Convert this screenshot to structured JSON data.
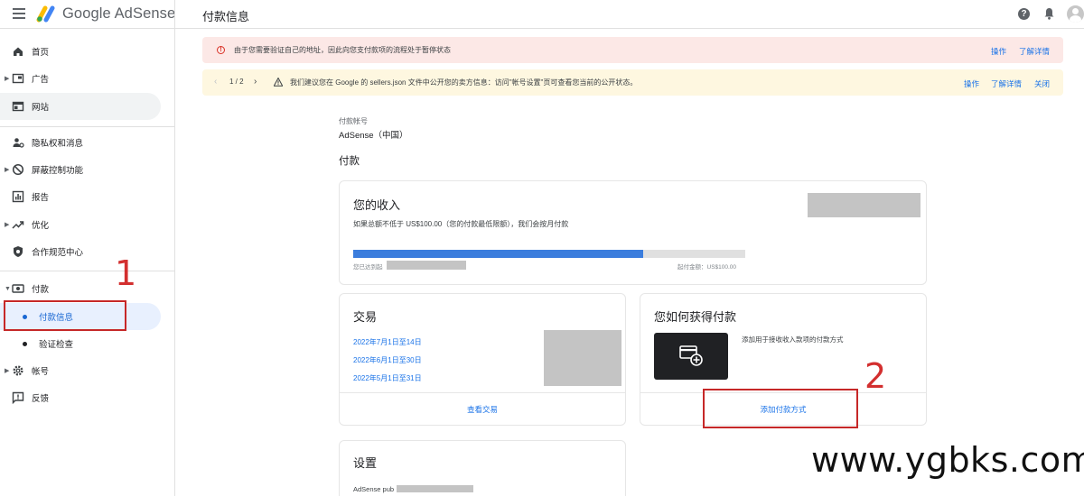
{
  "app": {
    "brand": "Google AdSense",
    "page_title": "付款信息",
    "icons": [
      "menu-icon",
      "adsense-logo",
      "help-icon",
      "bell-icon",
      "avatar"
    ]
  },
  "sidebar": {
    "items": [
      {
        "label": "首页",
        "icon": "home-icon",
        "expandable": false
      },
      {
        "label": "广告",
        "icon": "ads-icon",
        "expandable": true
      },
      {
        "label": "网站",
        "icon": "sites-icon",
        "expandable": false
      },
      {
        "label": "隐私权和消息",
        "icon": "privacy-icon",
        "expandable": false
      },
      {
        "label": "屏蔽控制功能",
        "icon": "block-icon",
        "expandable": true
      },
      {
        "label": "报告",
        "icon": "reports-icon",
        "expandable": false
      },
      {
        "label": "优化",
        "icon": "optimize-icon",
        "expandable": true
      },
      {
        "label": "合作规范中心",
        "icon": "policy-icon",
        "expandable": false
      },
      {
        "label": "付款",
        "icon": "payments-icon",
        "expandable": true,
        "expanded": true
      },
      {
        "label": "付款信息",
        "sub": true,
        "active": true
      },
      {
        "label": "验证检查",
        "sub": true
      },
      {
        "label": "帐号",
        "icon": "gear-icon",
        "expandable": true
      },
      {
        "label": "反馈",
        "icon": "feedback-icon",
        "expandable": false
      }
    ]
  },
  "alerts": {
    "error": {
      "message": "由于您需要验证自己的地址，因此向您支付款项的流程处于暂停状态",
      "actions": [
        "操作",
        "了解详情"
      ]
    },
    "warning": {
      "pager": "1 / 2",
      "message": "我们建议您在 Google 的 sellers.json 文件中公开您的卖方信息：访问\"帐号设置\"页可查看您当前的公开状态。",
      "actions": [
        "操作",
        "了解详情",
        "关闭"
      ]
    }
  },
  "payment_account": {
    "label": "付款帐号",
    "value": "AdSense（中国）"
  },
  "payments_section": "付款",
  "earnings_card": {
    "title": "您的收入",
    "description": "如果总额不低于 US$100.00（您的付款最低限额），我们会按月付款",
    "progress_fraction": 0.74,
    "reached_label": "您已达到起",
    "threshold_label": "起付金额：US$100.00"
  },
  "transactions_card": {
    "title": "交易",
    "links": [
      "2022年7月1日至14日",
      "2022年6月1日至30日",
      "2022年5月1日至31日"
    ],
    "footer_link": "查看交易"
  },
  "payment_method_card": {
    "title": "您如何获得付款",
    "description": "添加用于接收收入款项的付款方式",
    "footer_link": "添加付款方式"
  },
  "settings_card": {
    "title": "设置",
    "publisher_label": "AdSense pub"
  },
  "annotations": {
    "num1": "1",
    "num2": "2",
    "watermark": "www.ygbks.com",
    "color": "#c62828"
  }
}
